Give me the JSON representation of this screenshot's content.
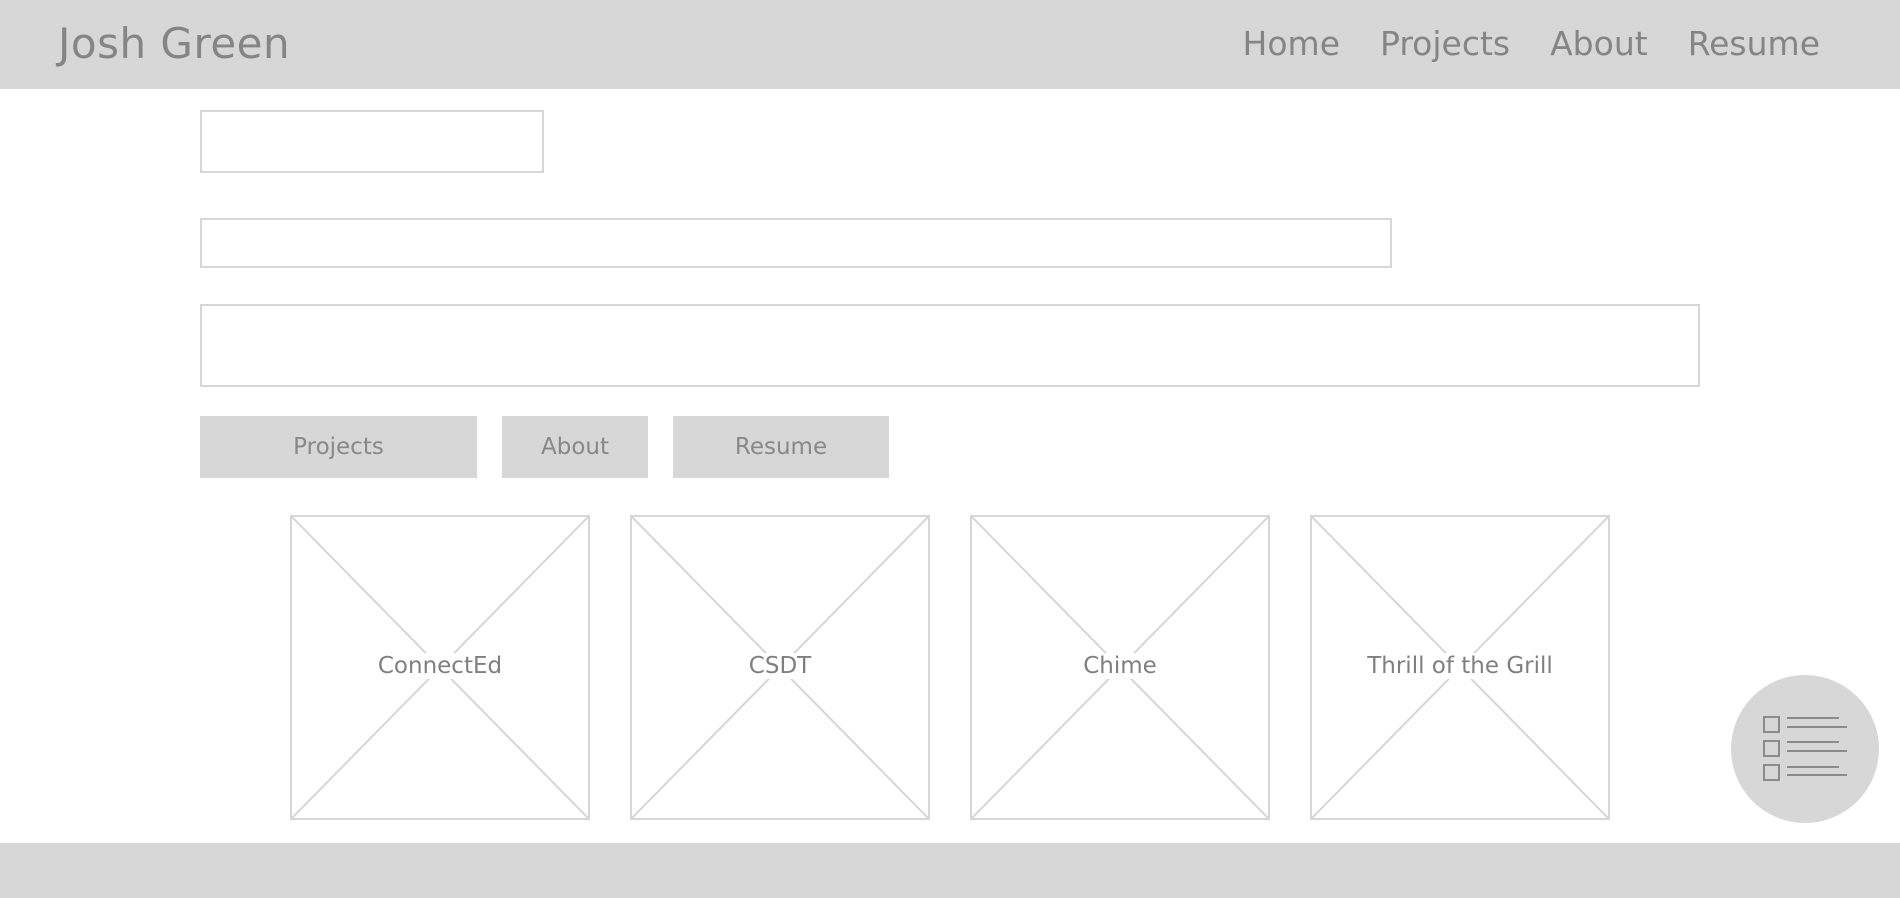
{
  "header": {
    "brand": "Josh Green",
    "nav": [
      "Home",
      "Projects",
      "About",
      "Resume"
    ]
  },
  "buttons": {
    "projects": "Projects",
    "about": "About",
    "resume": "Resume"
  },
  "projects": [
    "ConnectEd",
    "CSDT",
    "Chime",
    "Thrill of the Grill"
  ],
  "fab": {
    "icon": "checklist-icon"
  },
  "colors": {
    "bar": "#d7d7d7",
    "border": "#d6d6d6",
    "text": "#858585"
  }
}
